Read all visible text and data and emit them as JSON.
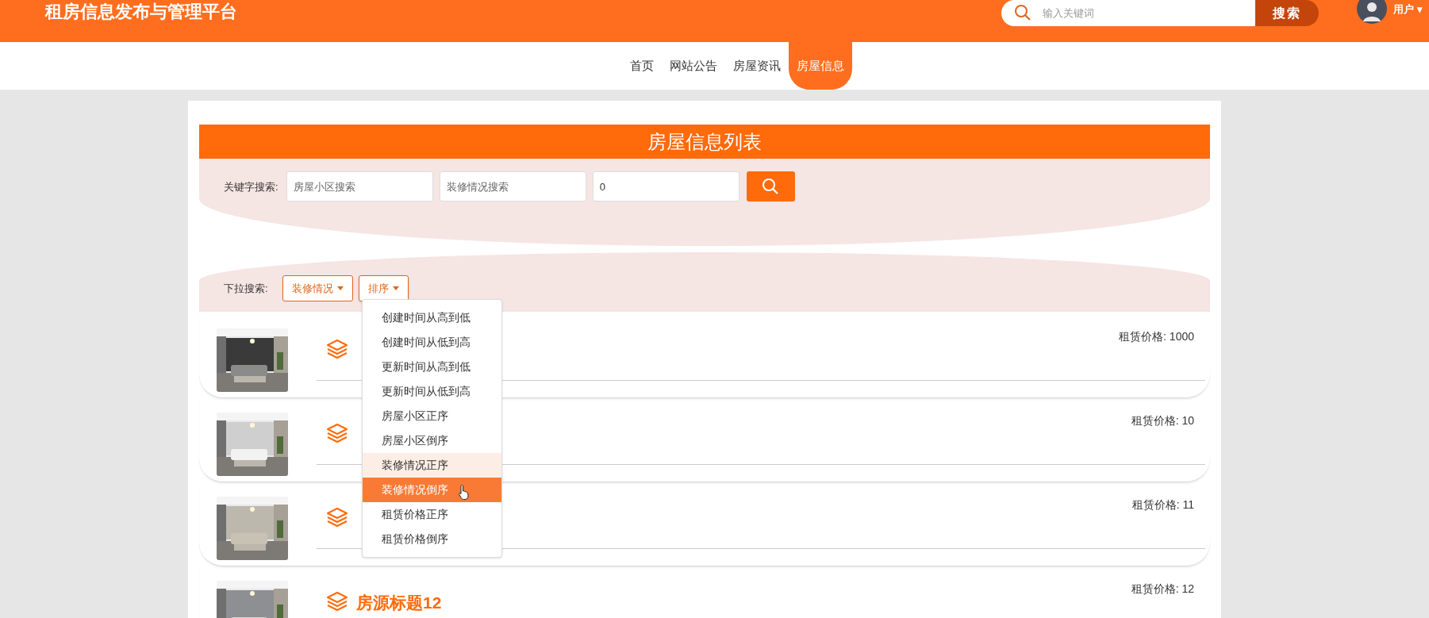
{
  "header": {
    "site_title": "租房信息发布与管理平台",
    "search": {
      "placeholder": "输入关键词",
      "button": "搜索"
    },
    "user": {
      "label": "用户",
      "caret": "▾"
    }
  },
  "nav": [
    {
      "label": "首页",
      "selected": false
    },
    {
      "label": "网站公告",
      "selected": false
    },
    {
      "label": "房屋资讯",
      "selected": false
    },
    {
      "label": "房屋信息",
      "selected": true
    }
  ],
  "list_title": "房屋信息列表",
  "keyword_search": {
    "label": "关键字搜索:",
    "fields": [
      {
        "placeholder": "房屋小区搜索"
      },
      {
        "placeholder": "装修情况搜索"
      },
      {
        "value": "0"
      }
    ]
  },
  "dropdown_search": {
    "label": "下拉搜索:",
    "buttons": [
      {
        "label": "装修情况",
        "open": false
      },
      {
        "label": "排序",
        "open": true
      }
    ],
    "menu": [
      {
        "label": "创建时间从高到低",
        "hovered": false,
        "selected": false
      },
      {
        "label": "创建时间从低到高",
        "hovered": false,
        "selected": false
      },
      {
        "label": "更新时间从高到低",
        "hovered": false,
        "selected": false
      },
      {
        "label": "更新时间从低到高",
        "hovered": false,
        "selected": false
      },
      {
        "label": "房屋小区正序",
        "hovered": false,
        "selected": false
      },
      {
        "label": "房屋小区倒序",
        "hovered": false,
        "selected": false
      },
      {
        "label": "装修情况正序",
        "hovered": false,
        "selected": true
      },
      {
        "label": "装修情况倒序",
        "hovered": true,
        "selected": false
      },
      {
        "label": "租赁价格正序",
        "hovered": false,
        "selected": false
      },
      {
        "label": "租赁价格倒序",
        "hovered": false,
        "selected": false
      }
    ]
  },
  "listings": [
    {
      "price": "租赁价格: 1000"
    },
    {
      "price": "租赁价格: 10"
    },
    {
      "price": "租赁价格: 11"
    },
    {
      "title": "房源标题12",
      "price": "租赁价格: 12"
    }
  ]
}
